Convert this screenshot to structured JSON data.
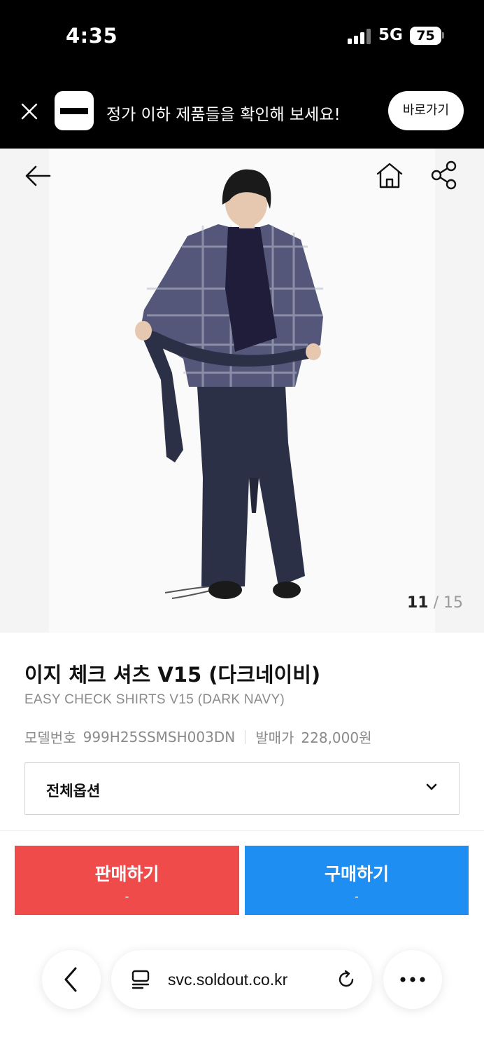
{
  "status_bar": {
    "time": "4:35",
    "network": "5G",
    "battery": "75"
  },
  "promo": {
    "text": "정가 이하 제품들을 확인해 보세요!",
    "button_label": "바로가기"
  },
  "gallery": {
    "current": "11",
    "separator": "/",
    "total": "15"
  },
  "product": {
    "name_ko": "이지 체크 셔츠 V15 (다크네이비)",
    "name_en": "EASY CHECK SHIRTS V15 (DARK NAVY)",
    "model_label": "모델번호",
    "model_value": "999H25SSMSH003DN",
    "release_price_label": "발매가",
    "release_price_value": "228,000원"
  },
  "options": {
    "label": "전체옵션"
  },
  "actions": {
    "sell": {
      "label": "판매하기",
      "price": "-"
    },
    "buy": {
      "label": "구매하기",
      "price": "-"
    }
  },
  "browser": {
    "url": "svc.soldout.co.kr"
  },
  "colors": {
    "sell": "#ef4b4b",
    "buy": "#1e8ef2",
    "banner": "#000000"
  },
  "icons": [
    "close-icon",
    "app-logo-icon",
    "back-arrow-icon",
    "home-icon",
    "share-icon",
    "chevron-down-icon",
    "browser-back-icon",
    "tabs-icon",
    "reload-icon",
    "more-icon"
  ]
}
